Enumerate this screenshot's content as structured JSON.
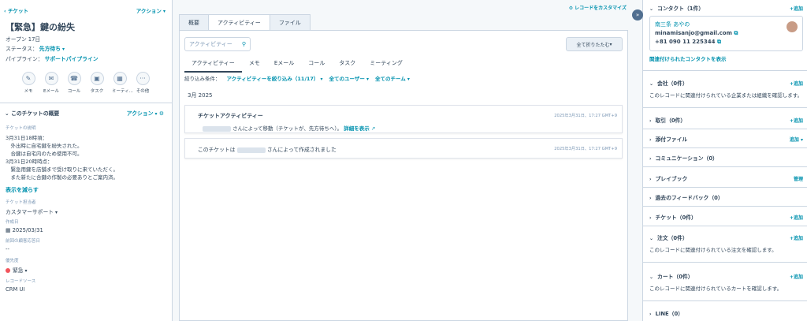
{
  "left": {
    "back_link": "チケット",
    "actions_label": "アクション",
    "title": "【緊急】鍵の紛失",
    "open_label": "オープン",
    "open_days": "17日",
    "status_label": "ステータス：",
    "status_value": "先方待ち",
    "pipeline_label": "パイプライン：",
    "pipeline_value": "サポートパイプライン",
    "action_buttons": [
      {
        "icon": "pencil",
        "label": "メモ"
      },
      {
        "icon": "envelope",
        "label": "Eメール"
      },
      {
        "icon": "phone",
        "label": "コール"
      },
      {
        "icon": "task",
        "label": "タスク"
      },
      {
        "icon": "calendar",
        "label": "ミーティ..."
      },
      {
        "icon": "more",
        "label": "その他"
      }
    ],
    "summary_title": "このチケットの概要",
    "summary_actions": "アクション",
    "desc_label": "チケットの説明",
    "desc_lines": [
      "3月31日18時頃：",
      "　外出時に自宅鍵を紛失された。",
      "　合鍵は自宅内のため使用不可。",
      "3月31日20時時点：",
      "　緊急用鍵を店舗まで受け取りに来ていただく。",
      "　また新たに合鍵の作製の必要ありとご案内済。"
    ],
    "show_less": "表示を減らす",
    "owner_label": "チケット担当者",
    "owner_value": "カスタマーサポート",
    "created_label": "作成日",
    "created_value": "2025/03/31",
    "last_activity_label": "前回の顧客応答日",
    "last_activity_value": "--",
    "priority_label": "優先度",
    "priority_value": "緊急",
    "source_label": "レコードソース",
    "source_value": "CRM UI"
  },
  "middle": {
    "customize_label": "レコードをカスタマイズ",
    "tabs": [
      "概要",
      "アクティビティー",
      "ファイル"
    ],
    "search_placeholder": "アクティビティー",
    "collapse_all": "全て折りたたむ",
    "subtabs": [
      "アクティビティー",
      "メモ",
      "Eメール",
      "コール",
      "タスク",
      "ミーティング"
    ],
    "filter_label": "絞り込み条件：",
    "filter_activity": "アクティビティーを絞り込み（11/17）",
    "filter_users": "全てのユーザー",
    "filter_teams": "全てのチーム",
    "month": "3月 2025",
    "entries": [
      {
        "title": "チケットアクティビティー",
        "text": "さんによって移動（チケットが、先方待ちへ）。",
        "link": "詳細を表示",
        "time": "2025年3月31日、17:27 GMT+9"
      },
      {
        "text_prefix": "このチケットは",
        "text_suffix": "さんによって作成されました",
        "time": "2025年3月31日、17:27 GMT+9"
      }
    ]
  },
  "right": {
    "contacts_title": "コンタクト（1件）",
    "add_label": "+追加",
    "contact_name": "南三条 あやの",
    "contact_email": "minamisanjo@gmail.com",
    "contact_phone": "+81 090 11 225344",
    "view_related_contacts": "関連付けられたコンタクトを表示",
    "sections": [
      {
        "title": "会社（0件）",
        "action": "+追加",
        "body": "このレコードに関連付けられている企業または組織を確認します。"
      },
      {
        "title": "取引（0件）",
        "action": "+追加"
      },
      {
        "title": "添付ファイル",
        "action": "追加"
      },
      {
        "title": "コミュニケーション（0）",
        "action": ""
      },
      {
        "title": "プレイブック",
        "action": "管理"
      },
      {
        "title": "過去のフィードバック（0）",
        "action": ""
      },
      {
        "title": "チケット（0件）",
        "action": "+追加"
      },
      {
        "title": "注文（0件）",
        "action": "+追加",
        "body": "このレコードに関連付けられている注文を確認します。"
      },
      {
        "title": "カート（0件）",
        "action": "+追加",
        "body": "このレコードに関連付けられているカートを確認します。"
      },
      {
        "title": "LINE（0）",
        "action": ""
      }
    ]
  }
}
